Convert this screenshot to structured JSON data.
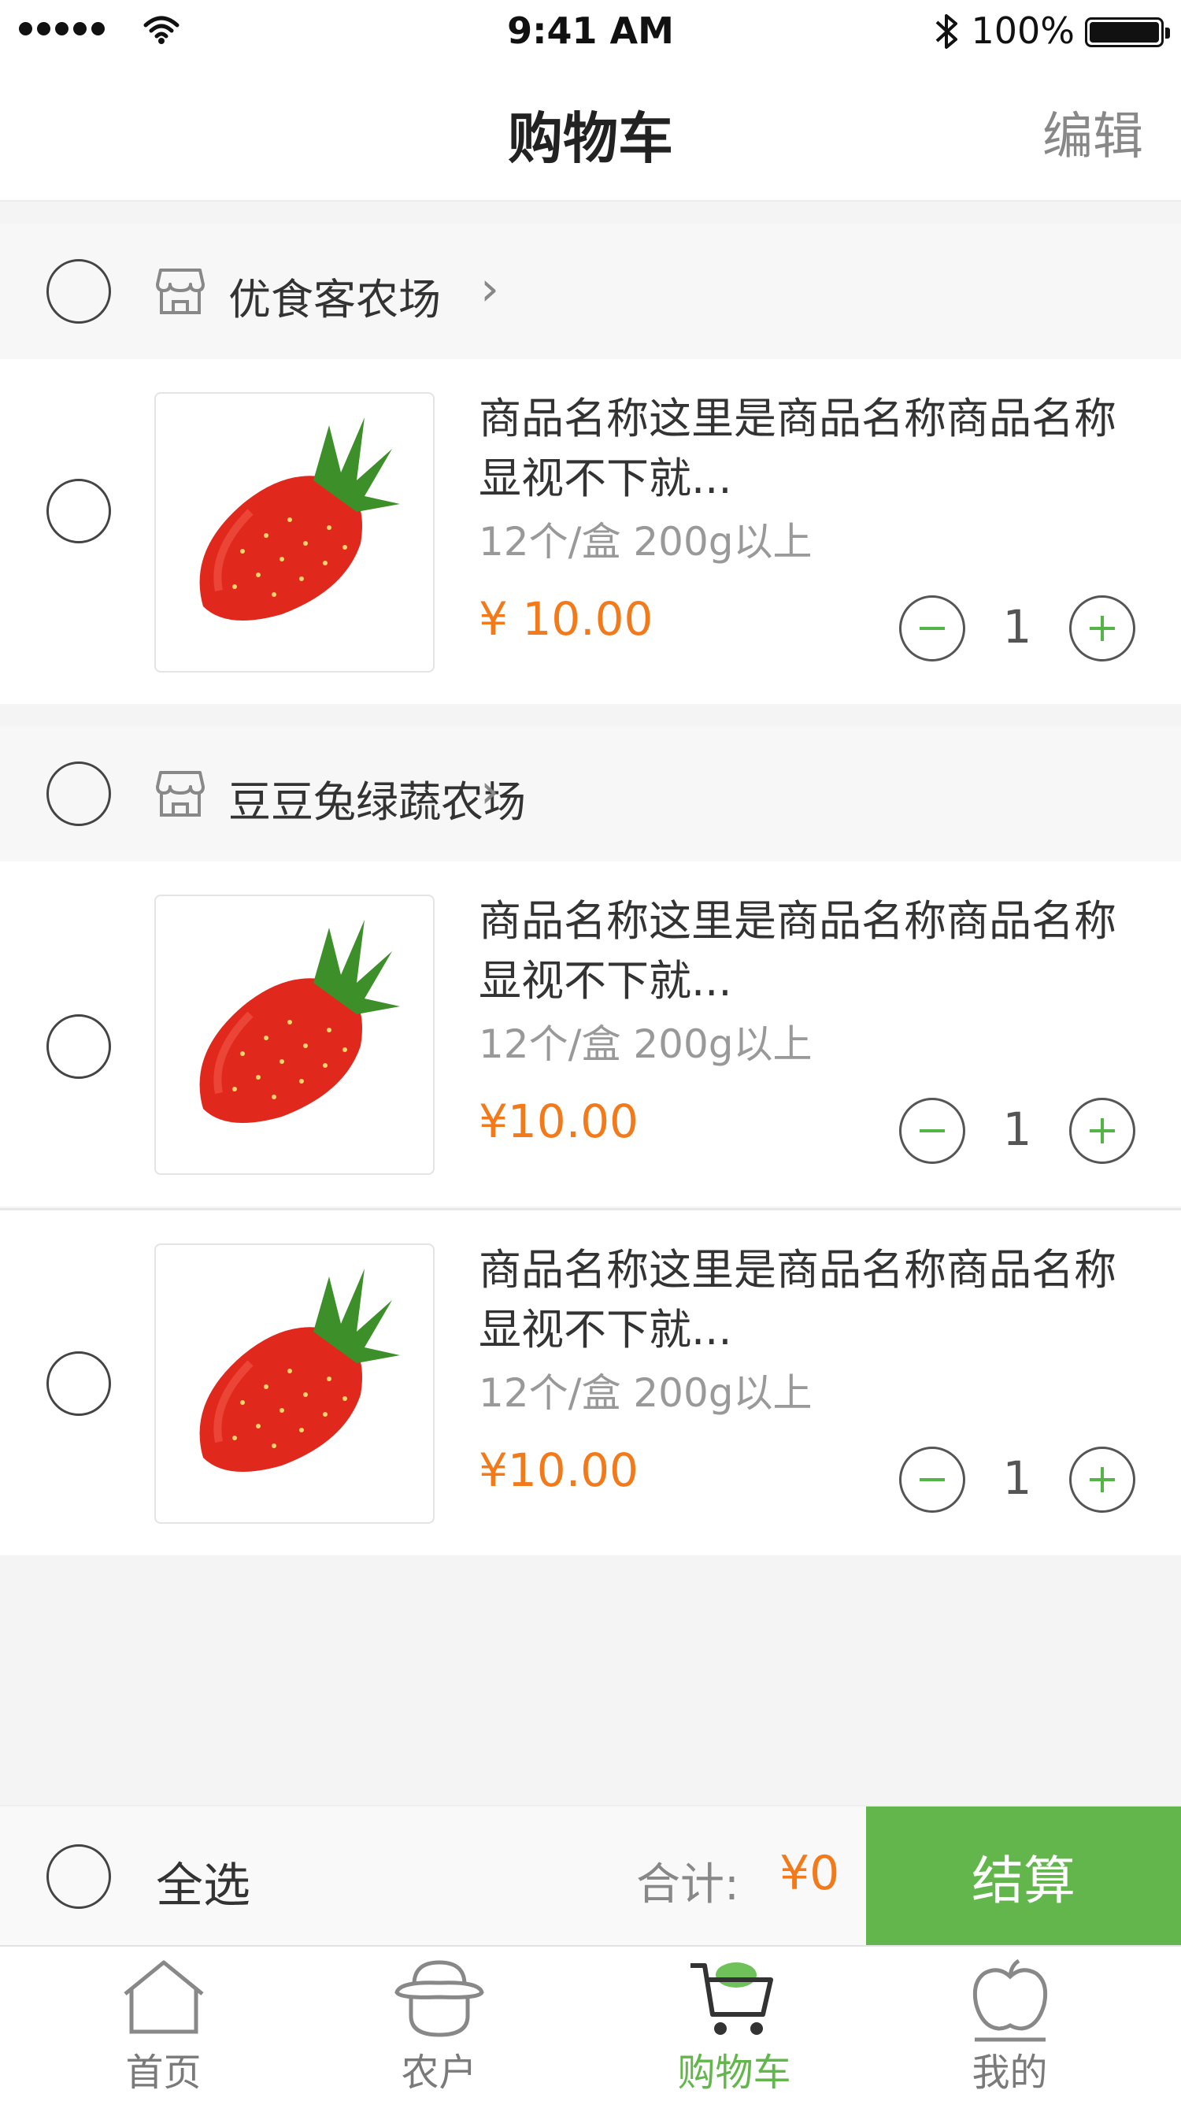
{
  "status_bar": {
    "time": "9:41 AM",
    "battery": "100%",
    "icons": [
      "signal-dots-icon",
      "wifi-icon",
      "bluetooth-icon",
      "battery-icon"
    ]
  },
  "nav": {
    "title": "购物车",
    "edit": "编辑"
  },
  "shops": [
    {
      "name": "优食客农场",
      "items": [
        {
          "name": "商品名称这里是商品名称商品名称显视不下就...",
          "spec": "12个/盒 200g以上",
          "price": "¥ 10.00",
          "qty": "1"
        }
      ]
    },
    {
      "name": "豆豆兔绿蔬农场",
      "items": [
        {
          "name": "商品名称这里是商品名称商品名称显视不下就...",
          "spec": "12个/盒 200g以上",
          "price": "¥10.00",
          "qty": "1"
        },
        {
          "name": "商品名称这里是商品名称商品名称显视不下就...",
          "spec": "12个/盒 200g以上",
          "price": "¥10.00",
          "qty": "1"
        }
      ]
    }
  ],
  "checkout": {
    "select_all": "全选",
    "total_label": "合计:",
    "total_value": "¥0",
    "button": "结算"
  },
  "tabs": [
    {
      "label": "首页",
      "icon": "home-icon",
      "active": false
    },
    {
      "label": "农户",
      "icon": "farmer-icon",
      "active": false
    },
    {
      "label": "购物车",
      "icon": "cart-icon",
      "active": true
    },
    {
      "label": "我的",
      "icon": "apple-icon",
      "active": false
    }
  ],
  "colors": {
    "accent_green": "#63b64b",
    "price_orange": "#f27a1a",
    "muted_text": "#999999"
  }
}
